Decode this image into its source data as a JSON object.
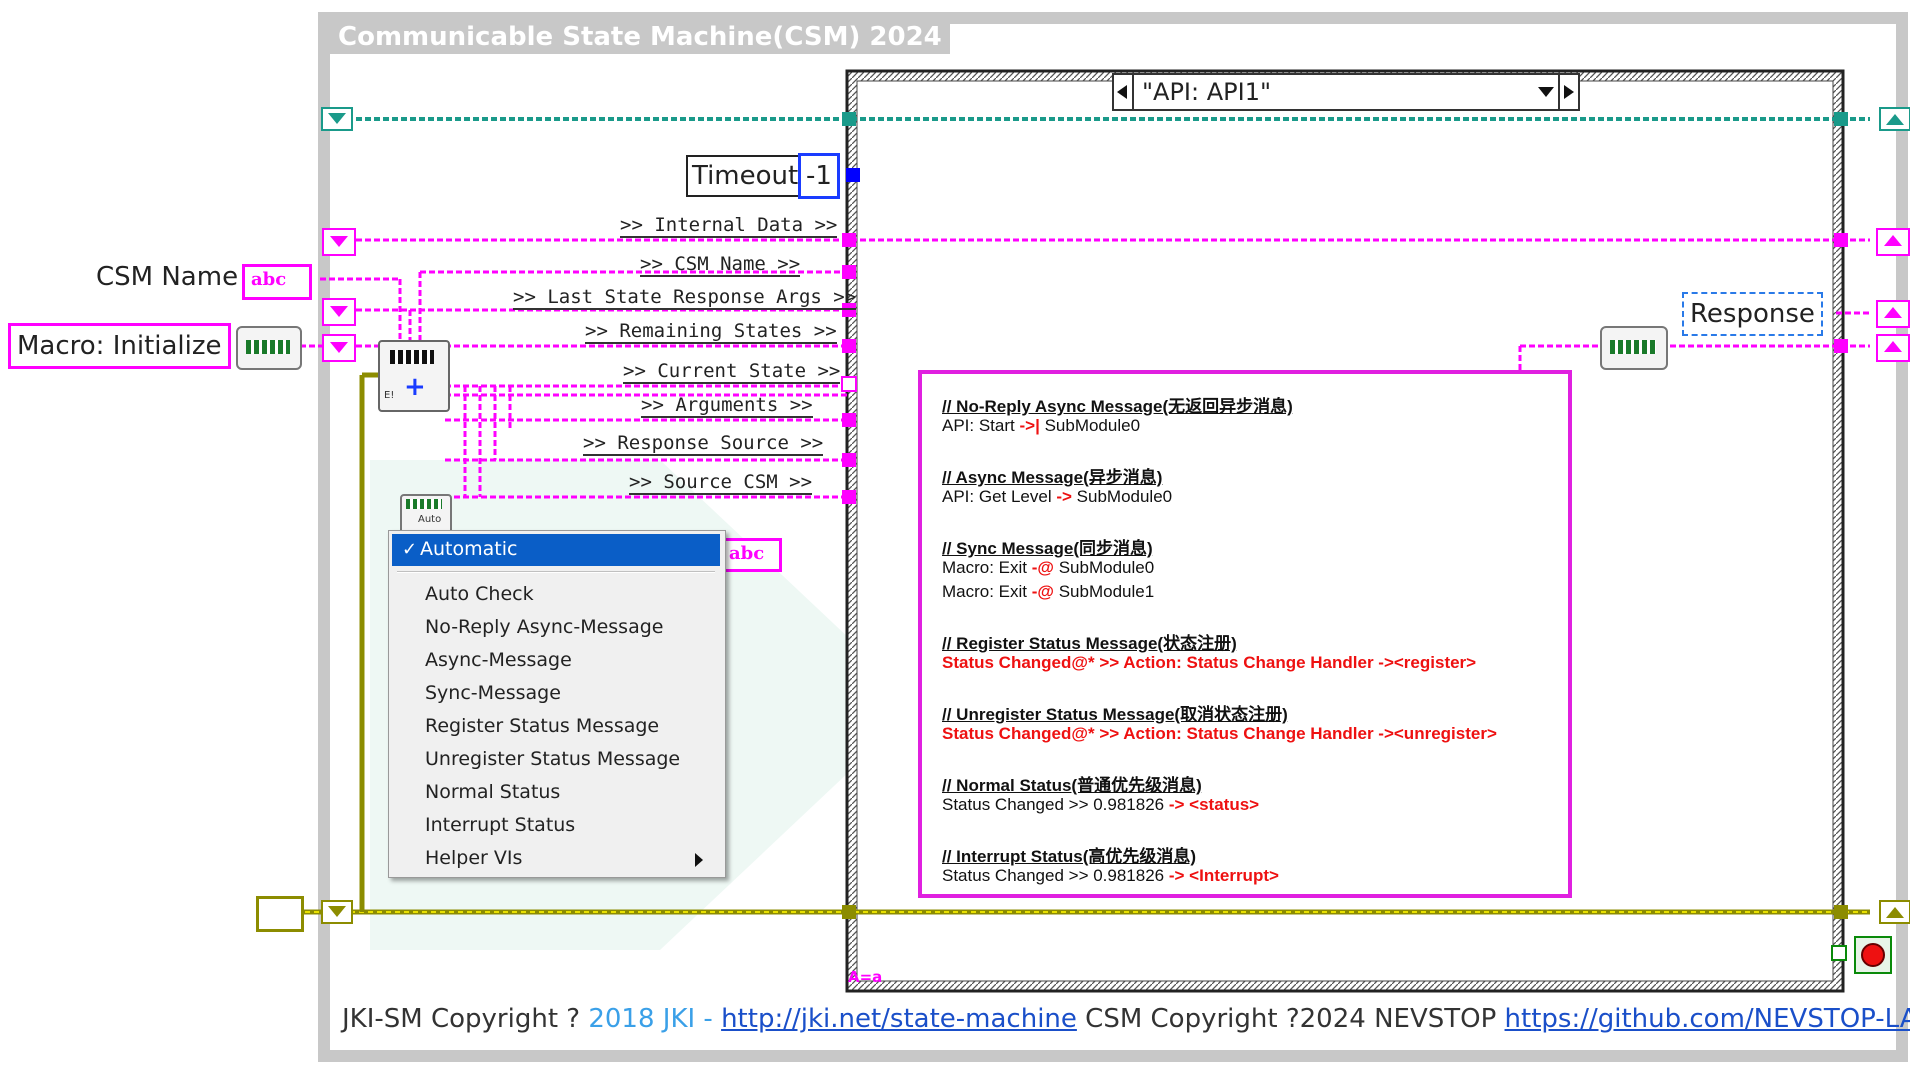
{
  "frame_title": "Communicable State Machine(CSM) 2024",
  "case_selector": "\"API: API1\"",
  "timeout": {
    "label": "Timeout",
    "value": "-1"
  },
  "wire_labels": [
    ">> Internal Data >>",
    ">> CSM Name >>",
    ">> Last State Response Args >>",
    ">> Remaining States >>",
    ">> Current State >>",
    ">> Arguments >>",
    ">> Response Source >>",
    ">> Source CSM >>"
  ],
  "controls": {
    "csm_name_label": "CSM Name",
    "csm_name_terminal": "abc",
    "macro_label": "Macro: Initialize",
    "response_label": "Response",
    "auto_badge": "Auto",
    "abc_tag": "abc",
    "loop_iteration": "A=a"
  },
  "context_menu": {
    "selected": "Automatic",
    "items": [
      "Auto Check",
      "No-Reply Async-Message",
      "Async-Message",
      "Sync-Message",
      "Register Status Message",
      "Unregister Status Message",
      "Normal Status",
      "Interrupt Status",
      "Helper VIs"
    ]
  },
  "comment": {
    "sections": [
      {
        "head": "// No-Reply Async Message(无返回异步消息)",
        "lines": [
          {
            "a": "API: Start ",
            "red": "->|",
            "b": " SubModule0"
          }
        ]
      },
      {
        "head": "// Async Message(异步消息)",
        "lines": [
          {
            "a": "API: Get Level ",
            "red": "->",
            "b": "  SubModule0"
          }
        ]
      },
      {
        "head": "// Sync Message(同步消息)",
        "lines": [
          {
            "a": "Macro: Exit ",
            "red": "-@",
            "b": " SubModule0"
          },
          {
            "a": "Macro: Exit ",
            "red": "-@",
            "b": " SubModule1"
          }
        ]
      },
      {
        "head": "// Register Status Message(状态注册)",
        "lines": [
          {
            "a": "",
            "red": "Status Changed@* >> Action: Status Change Handler -><register>",
            "b": ""
          }
        ]
      },
      {
        "head": "// Unregister Status Message(取消状态注册)",
        "lines": [
          {
            "a": "",
            "red": "Status Changed@* >> Action: Status Change Handler -><unregister>",
            "b": ""
          }
        ]
      },
      {
        "head": "// Normal Status(普通优先级消息)",
        "lines": [
          {
            "a": "Status Changed >> 0.981826 ",
            "red": "-> <status>",
            "b": ""
          }
        ]
      },
      {
        "head": "// Interrupt Status(高优先级消息)",
        "lines": [
          {
            "a": "Status Changed >> 0.981826 ",
            "red": "-> <Interrupt>",
            "b": ""
          }
        ]
      }
    ]
  },
  "footer": {
    "jki_prefix": "JKI-SM Copyright ? ",
    "jki_year": "2018 JKI - ",
    "jki_link": "http://jki.net/state-machine",
    "csm_text": " CSM Copyright ?2024 NEVSTOP ",
    "csm_link": "https://github.com/NEVSTOP-LAB"
  },
  "colors": {
    "string_wire": "#ff00ff",
    "cluster_wire": "#1a9a8a",
    "error_wire": "#9a9a00",
    "frame": "#c8c8c8",
    "case_border": "#333333",
    "selection": "#0a5ec7",
    "comment_border": "#e020e0"
  }
}
